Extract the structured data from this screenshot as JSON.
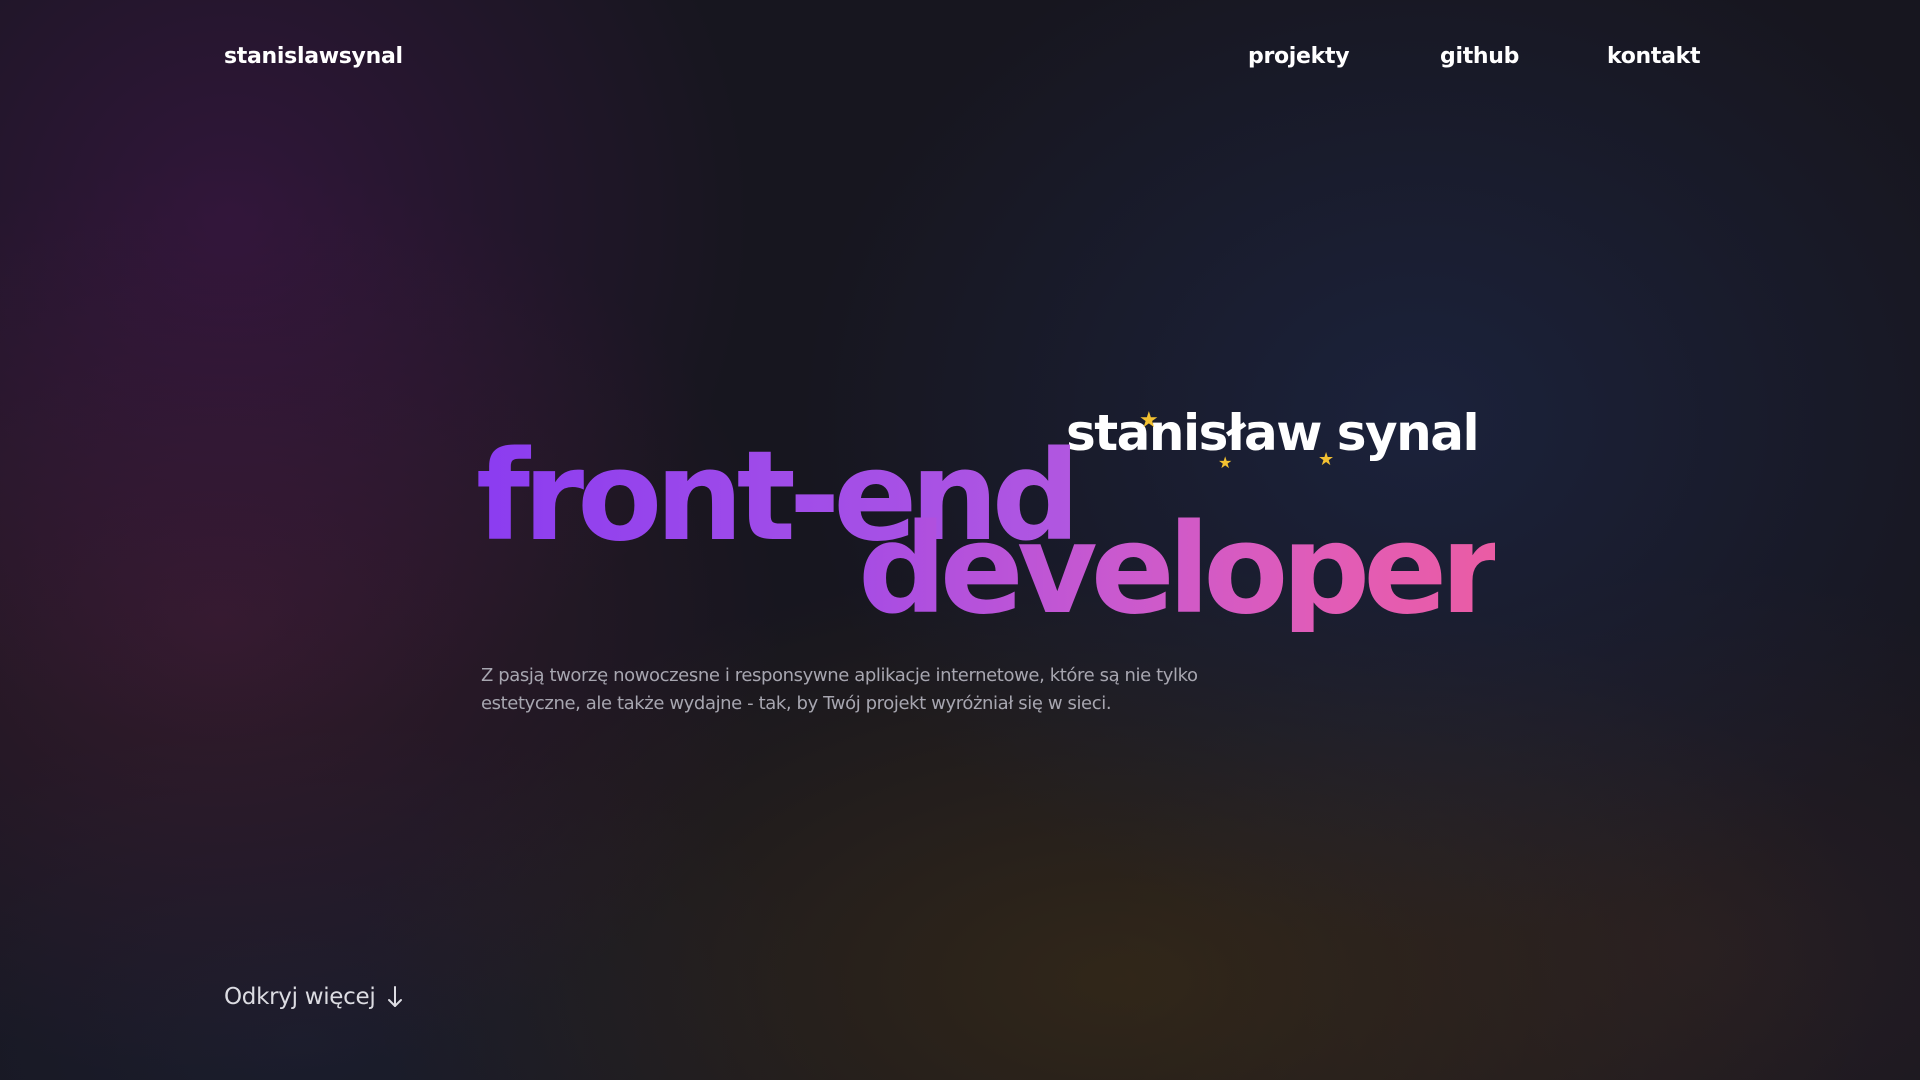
{
  "nav": {
    "logo": "stanislawsynal",
    "links": [
      "projekty",
      "github",
      "kontakt"
    ]
  },
  "hero": {
    "name": "stanisław synal",
    "title_line1": "front-end",
    "title_line2": "developer",
    "description": "Z pasją tworzę nowoczesne i responsywne aplikacje internetowe, które są nie tylko estetyczne, ale także wydajne - tak, by Twój projekt wyróżniał się w sieci."
  },
  "cta": {
    "label": "Odkryj więcej",
    "icon": "arrow-down-icon"
  },
  "colors": {
    "background": "#17161f",
    "star": "#f3c131",
    "gradient_start": "#8b3cf0",
    "gradient_end": "#ea5ca4",
    "description": "#a7a6b0"
  }
}
